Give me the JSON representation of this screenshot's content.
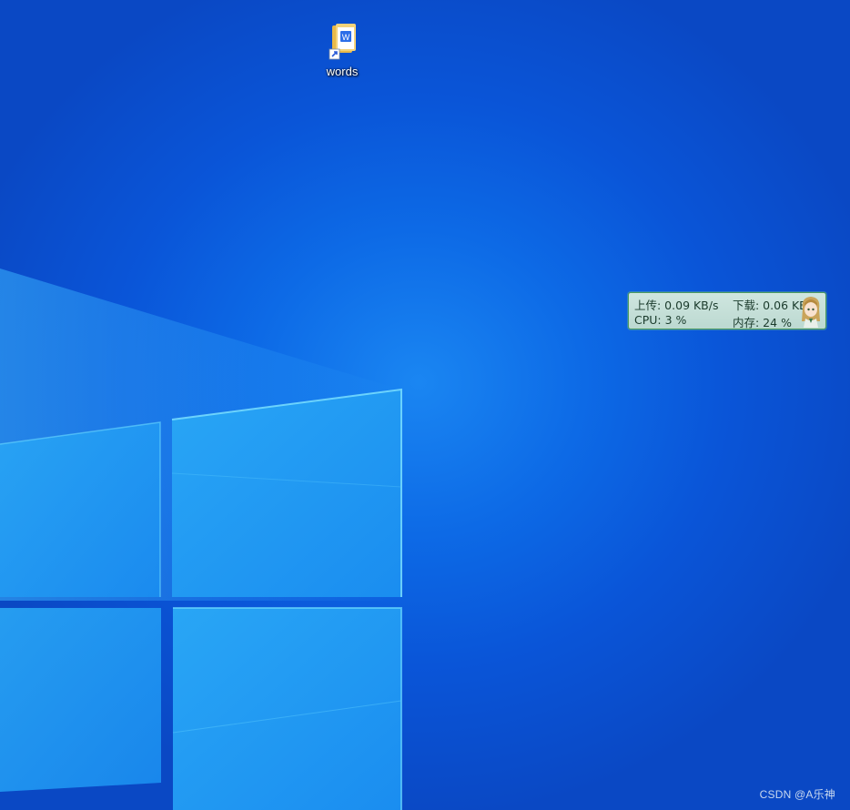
{
  "desktop": {
    "icons": [
      {
        "label": "words",
        "icon": "wps-document-folder-shortcut-icon"
      }
    ]
  },
  "monitor": {
    "upload": "上传: 0.09 KB/s",
    "download": "下载: 0.06 KB/s",
    "cpu": "CPU: 3 %",
    "memory": "内存: 24 %"
  },
  "watermark": "CSDN @A乐神",
  "colors": {
    "wallpaper_blue": "#0a55d8",
    "monitor_bg": "#c8e1da",
    "monitor_border": "#4d9a5e"
  }
}
